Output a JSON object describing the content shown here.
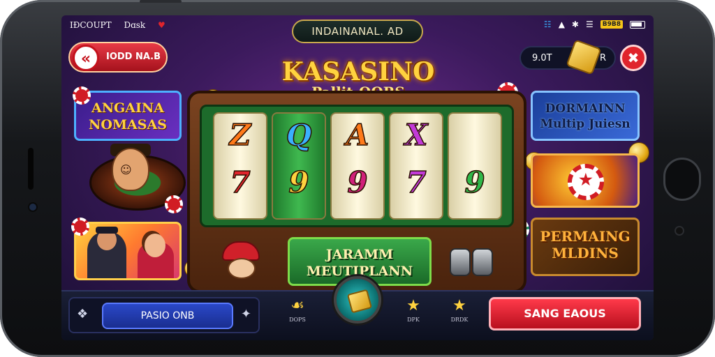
{
  "status": {
    "left_text_1": "IÐCOUPT",
    "left_text_2": "Dɑsk",
    "batt_label": "B9B8"
  },
  "top_pill": "INDAINANAL. AD",
  "back_label": "IODD NA.B",
  "coins": {
    "amount": "9.0T",
    "tail": "R"
  },
  "title": {
    "line1": "KASASINO",
    "line2": "Pallit-OORS"
  },
  "cards": {
    "left_top": [
      "ANGAINA",
      "NOMASAS"
    ],
    "right_top": [
      "DORMAINN",
      "Multip Juiesn"
    ],
    "right_bot": [
      "PERMAING",
      "MLDINS"
    ]
  },
  "reels": {
    "top": [
      "Z",
      "Q",
      "A",
      "X",
      ""
    ],
    "bottom": [
      "7",
      "9",
      "9",
      "7",
      "9"
    ]
  },
  "cabinet_label": [
    "JARAMM",
    "MEUTIPLANN"
  ],
  "bottom": {
    "input_label": "PASIO ONB",
    "nav": [
      {
        "label": "DOPS",
        "icon": "☙"
      },
      {
        "label": "DPK",
        "icon": "★"
      },
      {
        "label": "DRDK",
        "icon": "★"
      }
    ],
    "cta_label": "SANG EAOUS"
  },
  "colors": {
    "accent_red": "#e0242c",
    "gold": "#ffd23f",
    "felt_green": "#1d6b2b",
    "bg_purple": "#3b1a5c"
  }
}
